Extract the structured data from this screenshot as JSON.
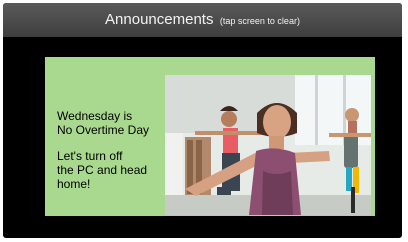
{
  "header": {
    "title": "Announcements",
    "hint": "(tap screen to clear)"
  },
  "announcement": {
    "line1": "Wednesday is",
    "line2": "No Overtime Day",
    "line3": "Let's turn off",
    "line4": "the PC and head",
    "line5": "home!"
  },
  "colors": {
    "header_bg": "#4a4a4a",
    "screen_bg": "#000000",
    "card_bg": "#a9d98f"
  }
}
